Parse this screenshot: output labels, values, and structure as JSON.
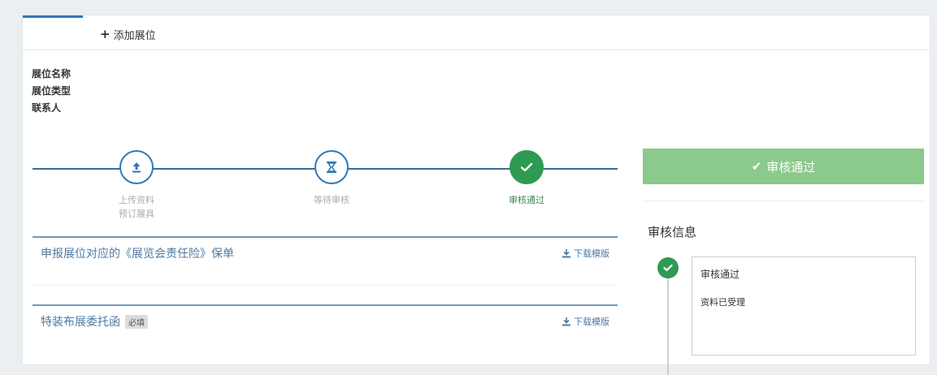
{
  "tabs": {
    "active_label": "",
    "add_label": "添加展位"
  },
  "booth_info": {
    "name_label": "展位名称",
    "type_label": "展位类型",
    "contact_label": "联系人"
  },
  "steps": [
    {
      "label_line1": "上传资料",
      "label_line2": "预订展具",
      "icon": "upload-icon",
      "status": "pending"
    },
    {
      "label_line1": "等待审核",
      "label_line2": "",
      "icon": "hourglass-icon",
      "status": "pending"
    },
    {
      "label_line1": "审核通过",
      "label_line2": "",
      "icon": "check-icon",
      "status": "done"
    }
  ],
  "attachments": [
    {
      "title": "申报展位对应的《展览会责任险》保单",
      "tag": "",
      "download_label": "下载模版"
    },
    {
      "title": "特装布展委托函",
      "tag": "必填",
      "download_label": "下载模版"
    }
  ],
  "review": {
    "status_button_label": "审核通过",
    "section_title": "审核信息",
    "timeline": [
      {
        "status": "审核通过",
        "note": "资料已受理"
      }
    ]
  },
  "colors": {
    "primary": "#2f79b9",
    "success": "#2f9a52",
    "success_light": "#8cc98c"
  }
}
